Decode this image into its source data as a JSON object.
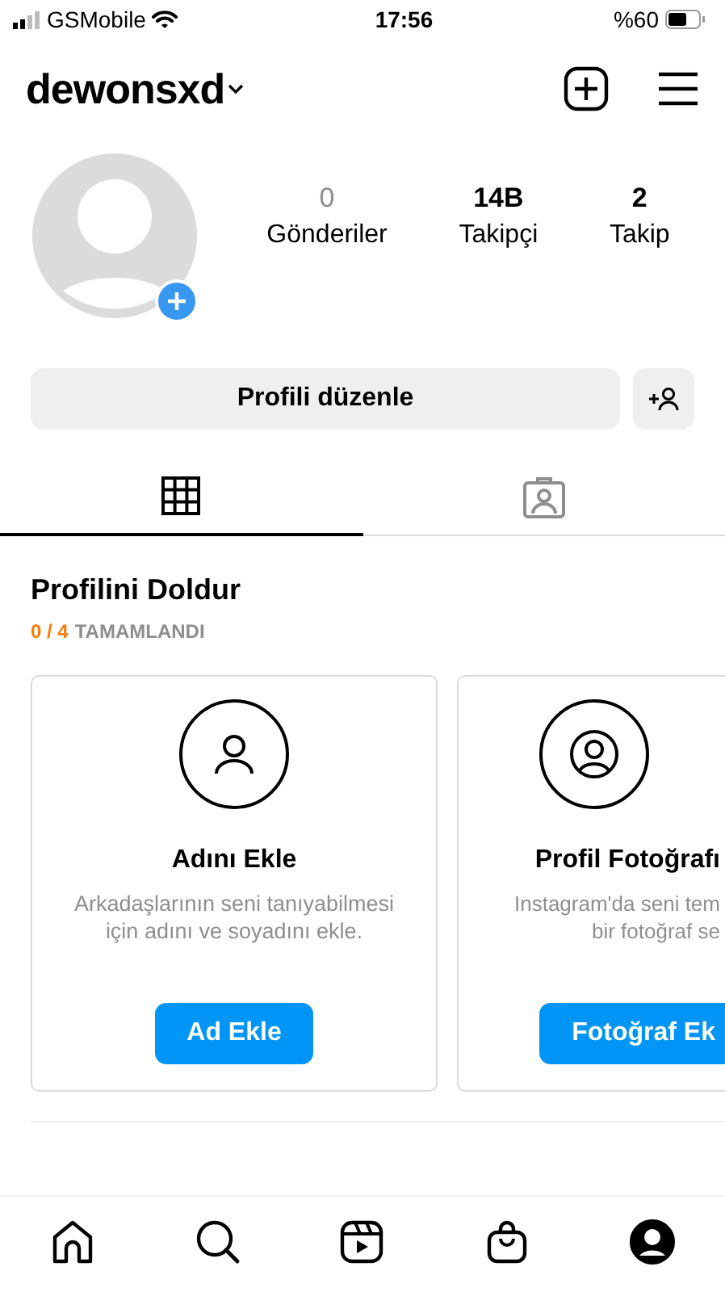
{
  "status_bar": {
    "carrier": "GSMobile",
    "time": "17:56",
    "battery": "%60"
  },
  "header": {
    "username": "dewonsxd"
  },
  "stats": [
    {
      "value": "0",
      "label": "Gönderiler",
      "dimmed": true
    },
    {
      "value": "14B",
      "label": "Takipçi",
      "dimmed": false
    },
    {
      "value": "2",
      "label": "Takip",
      "dimmed": false
    }
  ],
  "edit_button": "Profili düzenle",
  "tabs": [
    {
      "selected": true
    },
    {
      "selected": false
    }
  ],
  "section": {
    "title": "Profilini Doldur",
    "progress": "0 / 4",
    "progress_label": "TAMAMLANDI"
  },
  "cards": [
    {
      "title": "Adını Ekle",
      "description_lines": [
        "Arkadaşlarının seni tanıyabilmesi",
        "için adını ve soyadını ekle."
      ],
      "button": "Ad Ekle",
      "cut": false
    },
    {
      "title": "Profil Fotoğrafı",
      "description_lines": [
        "Instagram'da seni tem",
        "bir fotoğraf se"
      ],
      "button": "Fotoğraf Ek",
      "cut": true
    }
  ],
  "bottom_nav": [
    {
      "selected": false
    },
    {
      "selected": false
    },
    {
      "selected": false
    },
    {
      "selected": false
    },
    {
      "selected": true
    }
  ]
}
